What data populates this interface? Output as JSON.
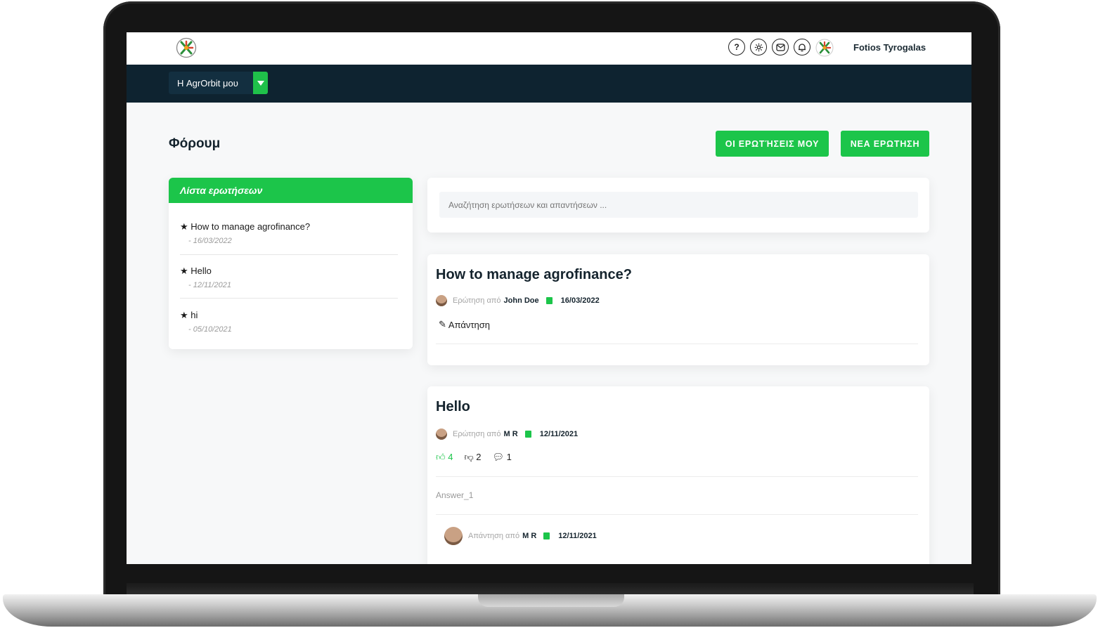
{
  "app": {
    "user_name": "Fotios Tyrogalas",
    "menu_label": "Η AgrOrbit μου",
    "top_icons": [
      "help-icon",
      "settings-icon",
      "messages-icon",
      "notifications-icon"
    ]
  },
  "page": {
    "title": "Φόρουμ",
    "my_questions_button": "ΟΙ ΕΡΩΤΉΣΕΙΣ ΜΟΥ",
    "new_question_button": "ΝΕΑ ΕΡΩΤΗΣΗ"
  },
  "question_list": {
    "heading": "Λίστα ερωτήσεων",
    "items": [
      {
        "title": "How to manage agrofinance?",
        "date": "- 16/03/2022"
      },
      {
        "title": "Hello",
        "date": "- 12/11/2021"
      },
      {
        "title": "hi",
        "date": "- 05/10/2021"
      }
    ]
  },
  "search": {
    "placeholder": "Αναζήτηση ερωτήσεων και απαντήσεων ..."
  },
  "posts": [
    {
      "title": "How to manage agrofinance?",
      "asked_by_label": "Ερώτηση από",
      "author": "John Doe",
      "date": "16/03/2022",
      "reply_label": "Απάντηση"
    },
    {
      "title": "Hello",
      "asked_by_label": "Ερώτηση από",
      "author": "M R",
      "date": "12/11/2021",
      "likes": "4",
      "dislikes": "2",
      "comments": "1",
      "answer_text": "Answer_1",
      "answer_by_label": "Απάντηση από",
      "answer_author": "M R",
      "answer_date": "12/11/2021"
    }
  ],
  "colors": {
    "accent_green": "#1cc54a",
    "navbar": "#0e2330",
    "text_dark": "#14232d"
  }
}
